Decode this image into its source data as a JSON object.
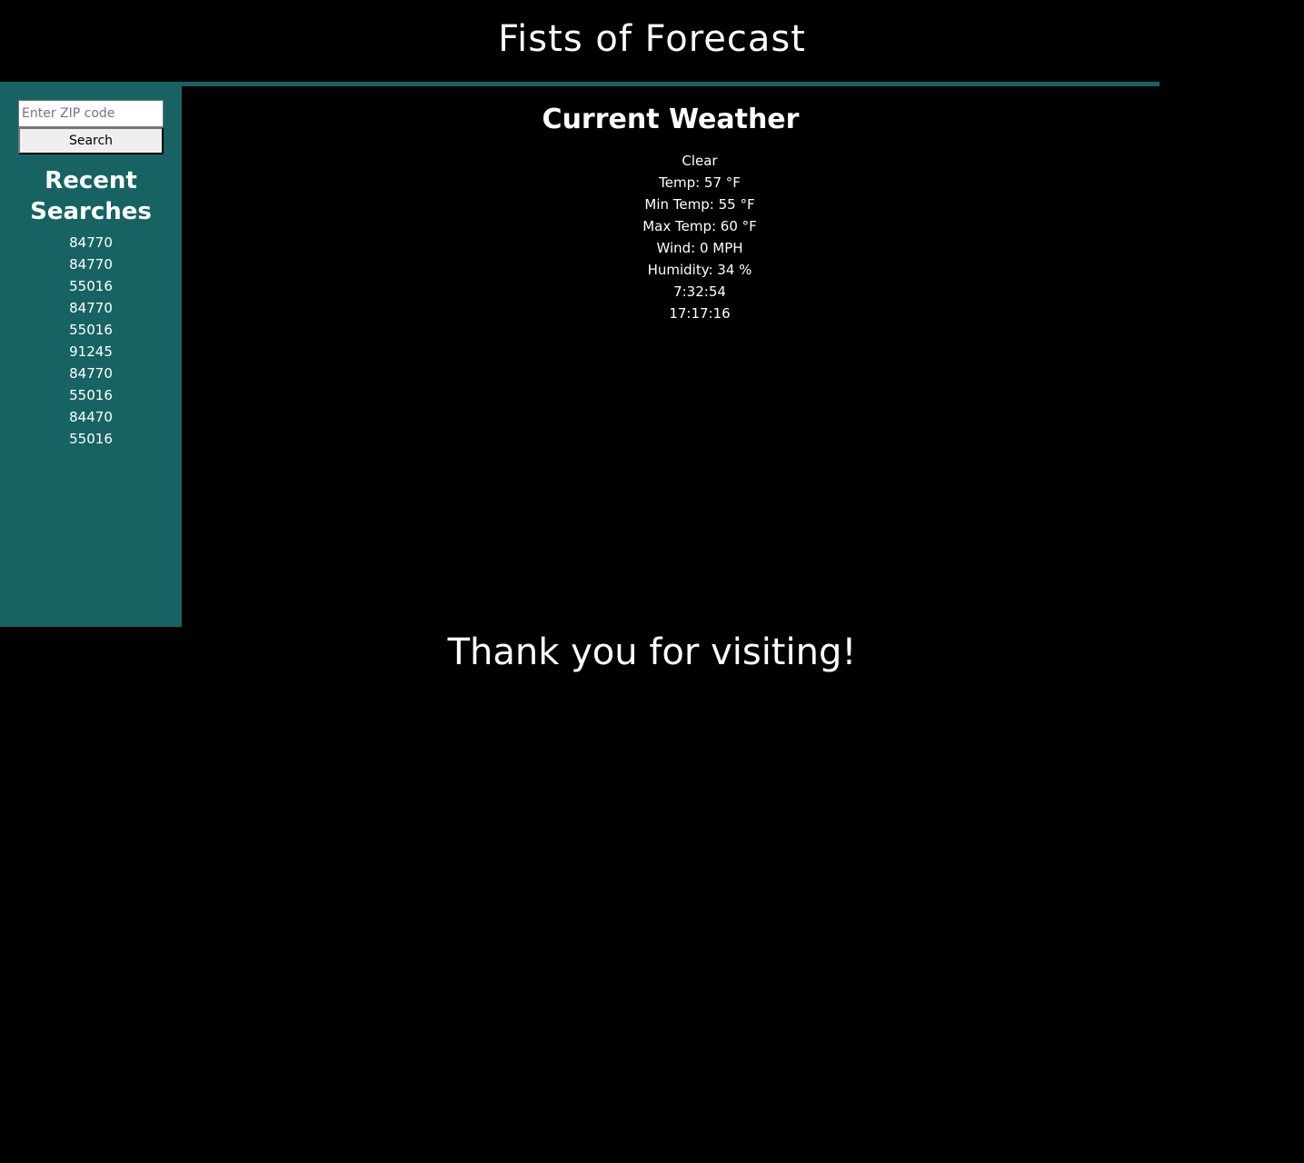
{
  "header": {
    "title": "Fists of Forecast"
  },
  "colors": {
    "background": "#000000",
    "sidebar": "#176363",
    "text": "#ffffff"
  },
  "sidebar": {
    "search_placeholder": "Enter ZIP code",
    "search_value": "",
    "search_button_label": "Search",
    "recent_heading": "Recent Searches",
    "recent_searches": [
      "84770",
      "84770",
      "55016",
      "84770",
      "55016",
      "91245",
      "84770",
      "55016",
      "84470",
      "55016"
    ]
  },
  "weather": {
    "heading": "Current Weather",
    "condition": "Clear",
    "temp": "Temp: 57 °F",
    "min_temp": "Min Temp: 55 °F",
    "max_temp": "Max Temp: 60 °F",
    "wind": "Wind: 0 MPH",
    "humidity": "Humidity: 34 %",
    "sunrise": "7:32:54",
    "sunset": "17:17:16"
  },
  "footer": {
    "message": "Thank you for visiting!"
  }
}
